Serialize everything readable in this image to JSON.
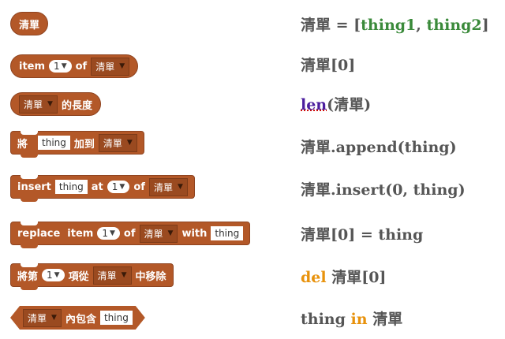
{
  "colors": {
    "block": "#b35828",
    "text": "#555555",
    "green": "#3a8a3a",
    "keyword_purple": "#4b1e9e",
    "keyword_orange": "#e8920c"
  },
  "rows": [
    {
      "block": {
        "var": "清單"
      },
      "python": {
        "a": "清單 = [",
        "b": "thing1",
        "c": ", ",
        "d": "thing2",
        "e": "]"
      }
    },
    {
      "block": {
        "w1": "item",
        "num": "1",
        "w2": "of",
        "list": "清單"
      },
      "python": {
        "a": "清單[0]"
      }
    },
    {
      "block": {
        "list": "清單",
        "w1": "的長度"
      },
      "python": {
        "kw": "len",
        "a": "(清單)"
      }
    },
    {
      "block": {
        "w1": "將",
        "txt": "thing",
        "w2": "加到",
        "list": "清單"
      },
      "python": {
        "a": "清單.append(thing)"
      }
    },
    {
      "block": {
        "w1": "insert",
        "txt": "thing",
        "w2": "at",
        "num": "1",
        "w3": "of",
        "list": "清單"
      },
      "python": {
        "a": "清單.insert(0, thing)"
      }
    },
    {
      "block": {
        "w1": "replace",
        "w2": "item",
        "num": "1",
        "w3": "of",
        "list": "清單",
        "w4": "with",
        "txt": "thing"
      },
      "python": {
        "a": "清單[0] = thing"
      }
    },
    {
      "block": {
        "w1": "將第",
        "num": "1",
        "w2": "項從",
        "list": "清單",
        "w3": "中移除"
      },
      "python": {
        "kw": "del",
        "a": " 清單[0]"
      }
    },
    {
      "block": {
        "list": "清單",
        "w1": "內包含",
        "txt": "thing"
      },
      "python": {
        "a": "thing ",
        "kw": "in",
        "b": " 清單"
      }
    }
  ],
  "icons": {
    "dropdown": "triangle-down"
  }
}
